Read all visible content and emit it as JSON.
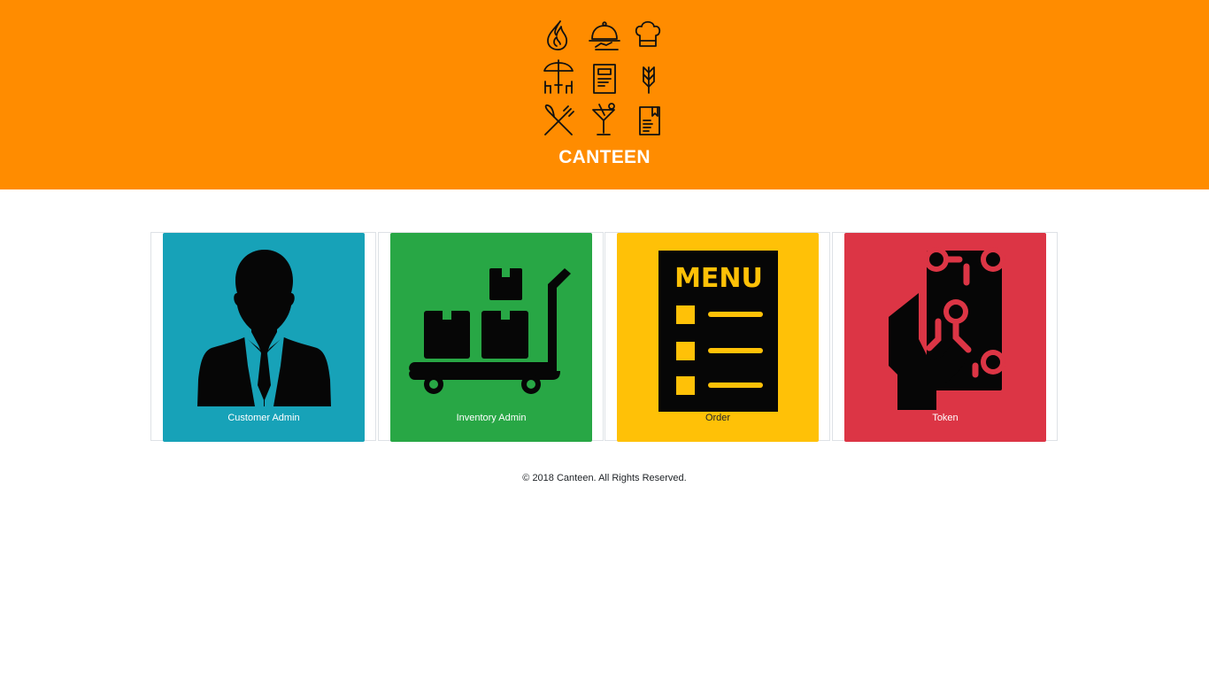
{
  "header": {
    "brand": "CANTEEN",
    "background_color": "#ff8c00",
    "logo_icons": [
      "flame-icon",
      "cloche-icon",
      "chef-hat-icon",
      "patio-table-icon",
      "menu-card-icon",
      "wheat-icon",
      "fork-knife-icon",
      "cocktail-icon",
      "recipe-book-icon"
    ]
  },
  "cards": [
    {
      "label": "Customer Admin",
      "color": "#17a2b8",
      "label_color": "#ffffff",
      "icon": "customer-admin-icon"
    },
    {
      "label": "Inventory Admin",
      "color": "#28a745",
      "label_color": "#ffffff",
      "icon": "inventory-cart-icon"
    },
    {
      "label": "Order",
      "color": "#ffc107",
      "label_color": "#212529",
      "icon": "menu-order-icon",
      "icon_text": "MENU"
    },
    {
      "label": "Token",
      "color": "#dc3545",
      "label_color": "#ffffff",
      "icon": "token-hand-icon"
    }
  ],
  "footer": {
    "text": "© 2018 Canteen. All Rights Reserved."
  }
}
